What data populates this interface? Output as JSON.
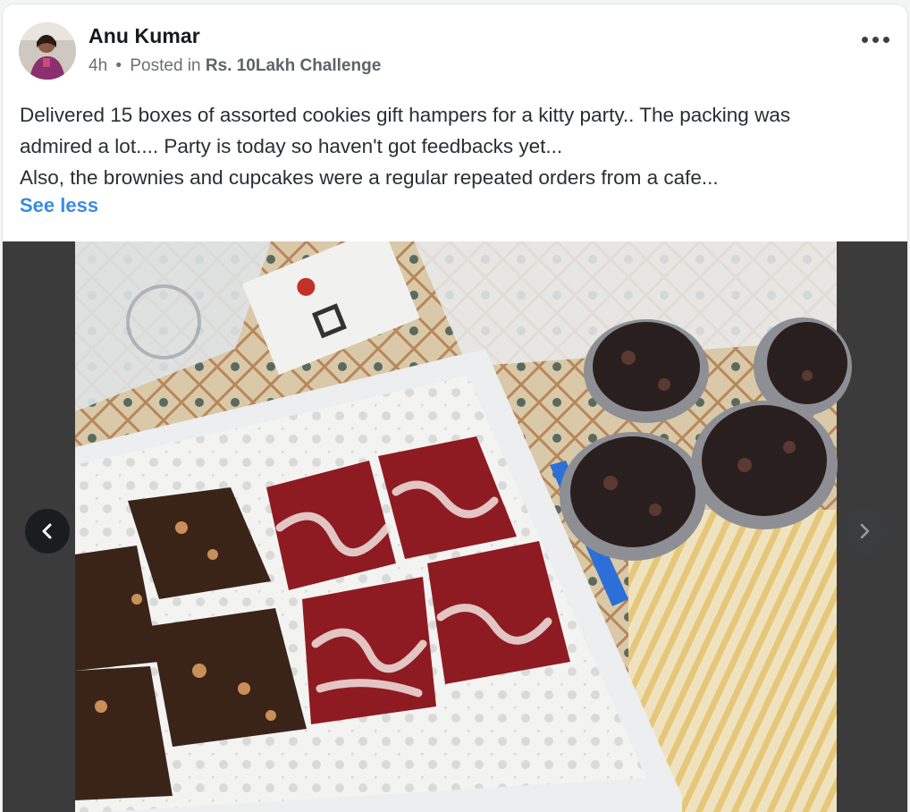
{
  "post": {
    "author": "Anu Kumar",
    "time": "4h",
    "separator": "•",
    "posted_in": "Posted in",
    "space": "Rs. 10Lakh Challenge",
    "body_lines": [
      "Delivered 15 boxes of assorted cookies gift hampers for a kitty party.. The packing was",
      "admired a lot.... Party is today so haven't got feedbacks yet...",
      "Also, the brownies and cupcakes were a regular repeated orders from a cafe..."
    ],
    "see_less": "See less"
  },
  "icons": {
    "more": "more-horizontal-icon",
    "prev": "chevron-left-icon",
    "next": "chevron-right-icon"
  },
  "colors": {
    "link": "#3b8be0",
    "brownie": "#3a2418",
    "red_velvet": "#8e1b22",
    "cupcake": "#2a1f1f"
  }
}
